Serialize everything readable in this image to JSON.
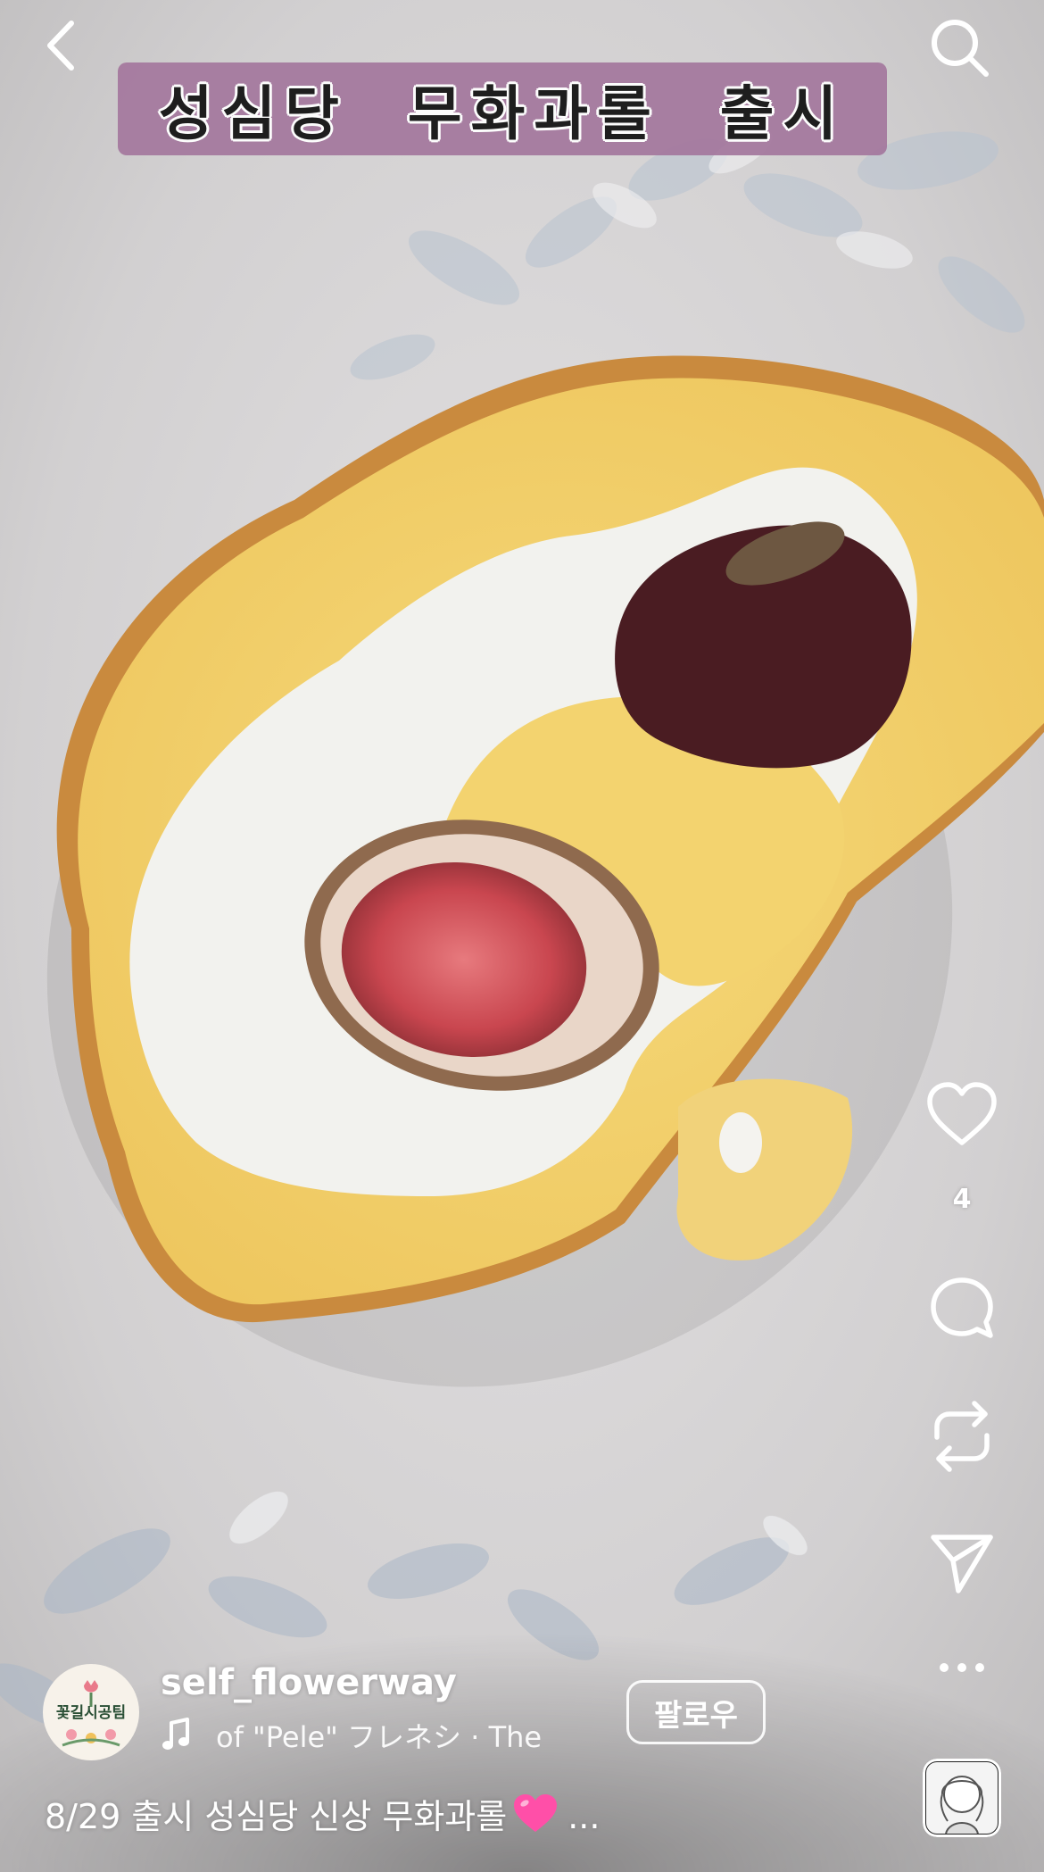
{
  "overlay": {
    "title": "성심당  무화과롤  출시"
  },
  "actions": {
    "like_count": "4"
  },
  "post": {
    "username": "self_flowerway",
    "avatar_text": "꽃길시공팀",
    "audio_track": "of \"Pele\"     フレネシ · The",
    "follow_label": "팔로우",
    "caption": "8/29 출시 성심당 신상 무화과롤",
    "caption_more": "..."
  },
  "icons": {
    "back": "chevron-left-icon",
    "search": "search-icon",
    "like": "heart-icon",
    "comment": "comment-icon",
    "repost": "repost-icon",
    "share": "send-icon",
    "more": "more-icon",
    "music": "music-note-icon",
    "caption_emoji": "pink-heart-emoji"
  },
  "colors": {
    "title_banner": "#a4789e",
    "caption_heart": "#ff4fa8",
    "plate": "#c9c8c9"
  }
}
